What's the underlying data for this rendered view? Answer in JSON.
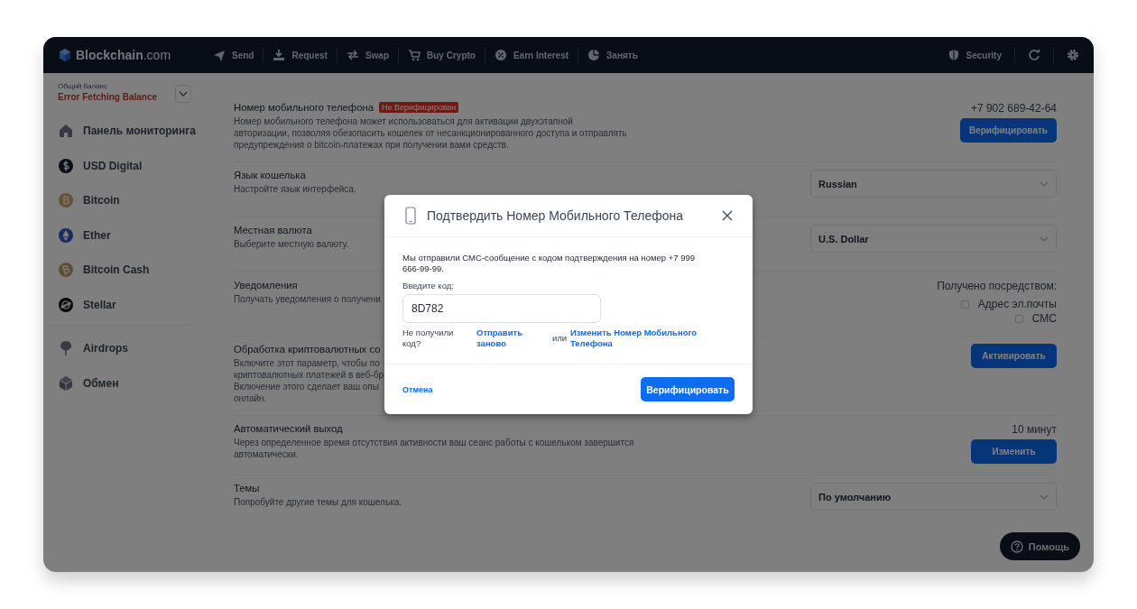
{
  "topbar": {
    "logo": "**Blockchain**.com",
    "nav": [
      {
        "label": "Send"
      },
      {
        "label": "Request"
      },
      {
        "label": "Swap"
      },
      {
        "label": "Buy Crypto"
      },
      {
        "label": "Earn Interest"
      },
      {
        "label": "Занять"
      }
    ],
    "security": "Security"
  },
  "sidebar": {
    "balance_label": "Общий баланс",
    "balance_value": "Error Fetching Balance",
    "groups": [
      [
        {
          "label": "Панель мониторинга"
        },
        {
          "label": "USD Digital"
        },
        {
          "label": "Bitcoin"
        },
        {
          "label": "Ether"
        },
        {
          "label": "Bitcoin Cash"
        },
        {
          "label": "Stellar"
        }
      ],
      [
        {
          "label": "Airdrops"
        },
        {
          "label": "Обмен"
        }
      ]
    ]
  },
  "settings": [
    {
      "title": "Номер мобильного телефона",
      "badge": "Не Верифицирован",
      "description_lines": [
        "Номер мобильного телефона может использоваться для активации двухэтапной",
        "авторизации, позволяя обезопасить кошелек от несанкционированного доступа и отправлять",
        "предупреждения о bitcoin-платежах при получении вами средств."
      ],
      "control": {
        "kind": "button",
        "value": "+7 902 689-42-64",
        "label": "Верифицировать"
      }
    },
    {
      "title": "Язык кошелька",
      "description_lines": [
        "Настройте язык интерфейса."
      ],
      "control": {
        "kind": "select",
        "value": "Russian"
      }
    },
    {
      "title": "Местная валюта",
      "description_lines": [
        "Выберите местную валюту."
      ],
      "control": {
        "kind": "select",
        "value": "U.S. Dollar"
      }
    },
    {
      "title": "Уведомления",
      "description_lines": [
        "Получать уведомления о получени"
      ],
      "control": {
        "kind": "checkboxes",
        "caption": "Получено посредством:",
        "options": [
          {
            "label": "Адрес эл.почты",
            "checked": false
          },
          {
            "label": "СМС",
            "checked": false
          }
        ]
      }
    },
    {
      "title": "Обработка криптовалютных со",
      "description_lines": [
        "Включите этот параметр, чтобы по",
        "криптовалютных платежей в веб-бр",
        "Включение этого сделает ваш опы",
        "онлайн."
      ],
      "control": {
        "kind": "button",
        "label": "Активировать"
      }
    },
    {
      "title": "Автоматический выход",
      "description_lines": [
        "Через определенное время отсутствия активности ваш сеанс работы с кошельком завершится",
        "автоматически."
      ],
      "control": {
        "kind": "button",
        "value": "10 минут",
        "label": "Изменить"
      }
    },
    {
      "title": "Темы",
      "description_lines": [
        "Попробуйте другие темы для кошелька."
      ],
      "control": {
        "kind": "select",
        "value": "По умолчанию"
      }
    }
  ],
  "help_button": "Помощь",
  "modal": {
    "title": "Подтвердить Номер Мобильного Телефона",
    "message": "Мы отправили СМС-сообщение с кодом подтверждения на номер +7 999 666-99-99.",
    "input_label": "Введите код:",
    "code": "8D782",
    "resend_prompt": "Не получили код?",
    "resend_link": "Отправить заново",
    "or": "или",
    "change_link": "Изменить Номер Мобильного Телефона",
    "cancel": "Отмена",
    "submit": "Верифицировать"
  }
}
